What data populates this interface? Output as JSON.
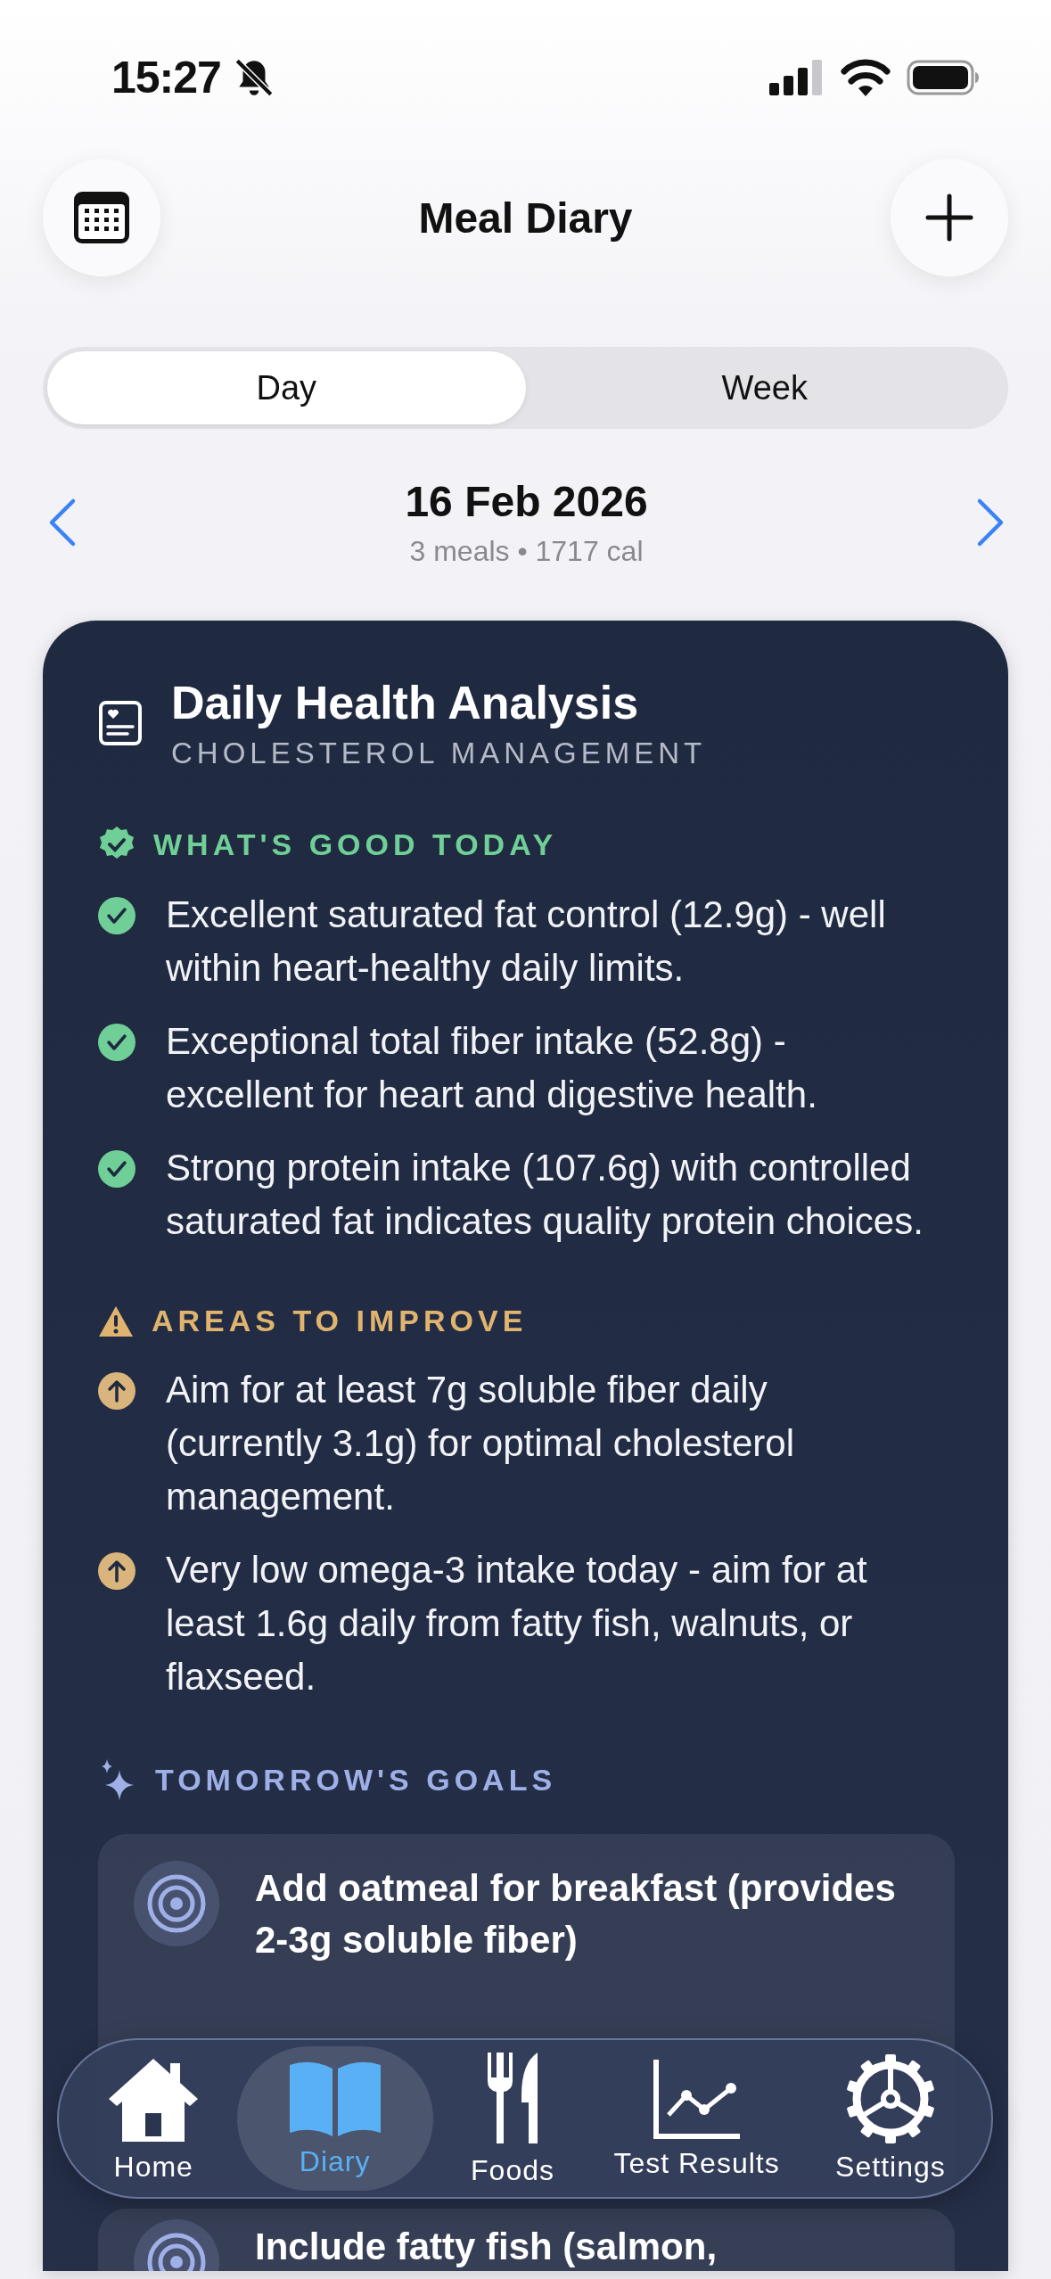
{
  "status_bar": {
    "time": "15:27"
  },
  "header": {
    "title": "Meal Diary"
  },
  "segments": [
    {
      "label": "Day",
      "selected": true
    },
    {
      "label": "Week",
      "selected": false
    }
  ],
  "date_nav": {
    "date": "16 Feb 2026",
    "summary": "3 meals • 1717 cal"
  },
  "analysis": {
    "title": "Daily Health Analysis",
    "subtitle": "CHOLESTEROL MANAGEMENT",
    "sections": [
      {
        "kind": "good",
        "heading": "WHAT'S GOOD TODAY",
        "items": [
          "Excellent saturated fat control (12.9g) - well within heart-healthy daily limits.",
          "Exceptional total fiber intake (52.8g) - excellent for heart and digestive health.",
          "Strong protein intake (107.6g) with controlled saturated fat indicates quality protein choices."
        ]
      },
      {
        "kind": "improve",
        "heading": "AREAS TO IMPROVE",
        "items": [
          "Aim for at least 7g soluble fiber daily (currently 3.1g) for optimal cholesterol management.",
          "Very low omega-3 intake today - aim for at least 1.6g daily from fatty fish, walnuts, or flaxseed."
        ]
      },
      {
        "kind": "goals",
        "heading": "TOMORROW'S GOALS",
        "items": [
          "Add oatmeal for breakfast (provides 2-3g soluble fiber)",
          "Include fatty fish (salmon,"
        ]
      }
    ]
  },
  "tab_bar": [
    {
      "kind": "home",
      "label": "Home",
      "selected": false
    },
    {
      "kind": "diary",
      "label": "Diary",
      "selected": true
    },
    {
      "kind": "foods",
      "label": "Foods",
      "selected": false
    },
    {
      "kind": "results",
      "label": "Test Results",
      "selected": false
    },
    {
      "kind": "settings",
      "label": "Settings",
      "selected": false
    }
  ]
}
